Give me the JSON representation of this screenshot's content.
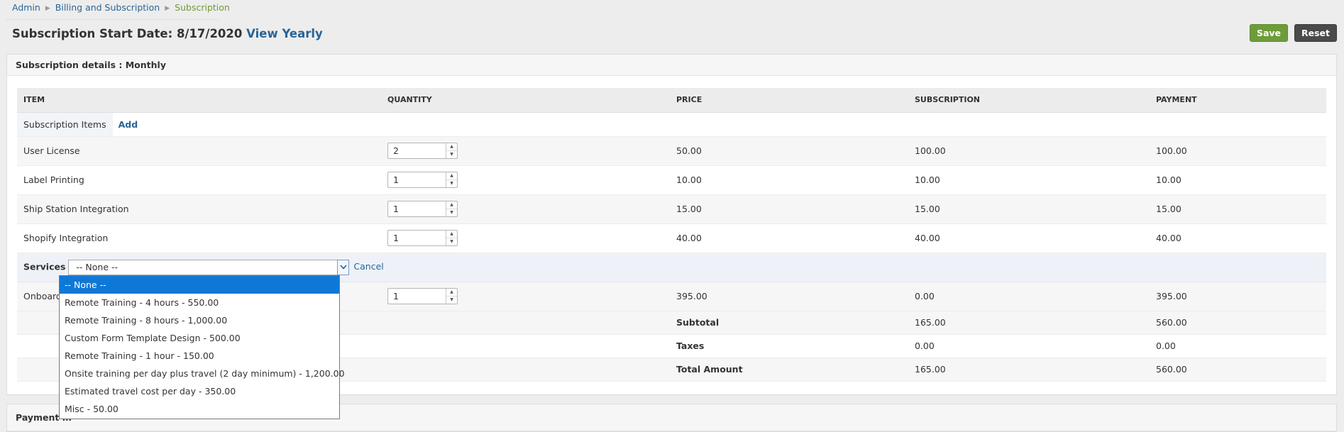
{
  "breadcrumb": {
    "admin": "Admin",
    "billing": "Billing and Subscription",
    "current": "Subscription"
  },
  "title": {
    "text": "Subscription Start Date: 8/17/2020",
    "link": "View Yearly"
  },
  "actions": {
    "save": "Save",
    "reset": "Reset"
  },
  "panel": {
    "title": "Subscription details : Monthly"
  },
  "table": {
    "headers": {
      "item": "ITEM",
      "quantity": "QUANTITY",
      "price": "PRICE",
      "subscription": "SUBSCRIPTION",
      "payment": "PAYMENT"
    },
    "items_label": "Subscription Items",
    "add": "Add",
    "rows": [
      {
        "item": "User License",
        "quantity": "2",
        "price": "50.00",
        "subscription": "100.00",
        "payment": "100.00"
      },
      {
        "item": "Label Printing",
        "quantity": "1",
        "price": "10.00",
        "subscription": "10.00",
        "payment": "10.00"
      },
      {
        "item": "Ship Station Integration",
        "quantity": "1",
        "price": "15.00",
        "subscription": "15.00",
        "payment": "15.00"
      },
      {
        "item": "Shopify Integration",
        "quantity": "1",
        "price": "40.00",
        "subscription": "40.00",
        "payment": "40.00"
      }
    ],
    "services": {
      "label": "Services",
      "selected": "-- None --",
      "cancel": "Cancel"
    },
    "onboard": {
      "item": "Onboard",
      "quantity": "1",
      "price": "395.00",
      "subscription": "0.00",
      "payment": "395.00"
    },
    "totals": [
      {
        "label": "Subtotal",
        "subscription": "165.00",
        "payment": "560.00"
      },
      {
        "label": "Taxes",
        "subscription": "0.00",
        "payment": "0.00"
      },
      {
        "label": "Total Amount",
        "subscription": "165.00",
        "payment": "560.00"
      }
    ]
  },
  "dropdown": {
    "options": [
      "-- None --",
      "Remote Training - 4 hours - 550.00",
      "Remote Training - 8 hours - 1,000.00",
      "Custom Form Template Design - 500.00",
      "Remote Training - 1 hour - 150.00",
      "Onsite training per day plus travel (2 day minimum) - 1,200.00",
      "Estimated travel cost per day - 350.00",
      "Misc - 50.00"
    ]
  },
  "panel2": {
    "title": "Payment m"
  }
}
